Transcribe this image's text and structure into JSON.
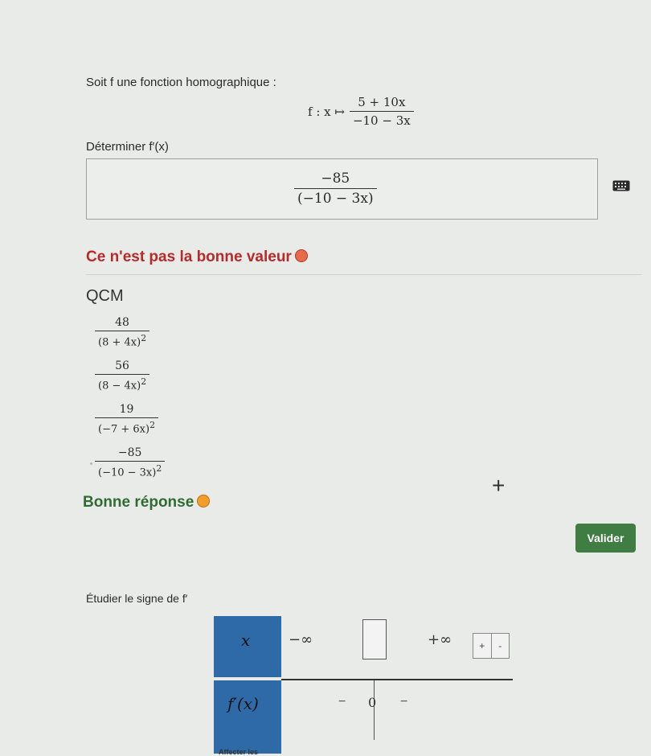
{
  "intro": "Soit f une fonction homographique :",
  "definition": {
    "prefix": "f : x ↦",
    "numerator": "5 + 10x",
    "denominator": "−10 − 3x"
  },
  "question": "Déterminer f′(x)",
  "answer": {
    "numerator": "−85",
    "denominator": "(−10 − 3x)",
    "keyboard_icon": "keyboard-icon"
  },
  "feedback_wrong": "Ce n'est pas la bonne valeur",
  "qcm": {
    "title": "QCM",
    "options": [
      {
        "numerator": "48",
        "denominator": "(8 + 4x)",
        "exponent": "2"
      },
      {
        "numerator": "56",
        "denominator": "(8 − 4x)",
        "exponent": "2"
      },
      {
        "numerator": "19",
        "denominator": "(−7 + 6x)",
        "exponent": "2"
      },
      {
        "numerator": "−85",
        "denominator": "(−10 − 3x)",
        "exponent": "2"
      }
    ]
  },
  "add_symbol": "+",
  "feedback_right": "Bonne réponse",
  "validate_label": "Valider",
  "sign_study": {
    "title": "Étudier le signe de f′",
    "x_label": "x",
    "fprime_label": "f′(x)",
    "neg_inf": "−∞",
    "pos_inf": "+∞",
    "plus": "+",
    "minus": "-",
    "sign_left": "−",
    "zero": "0",
    "sign_right": "−",
    "cut_label": "Affecter les"
  }
}
